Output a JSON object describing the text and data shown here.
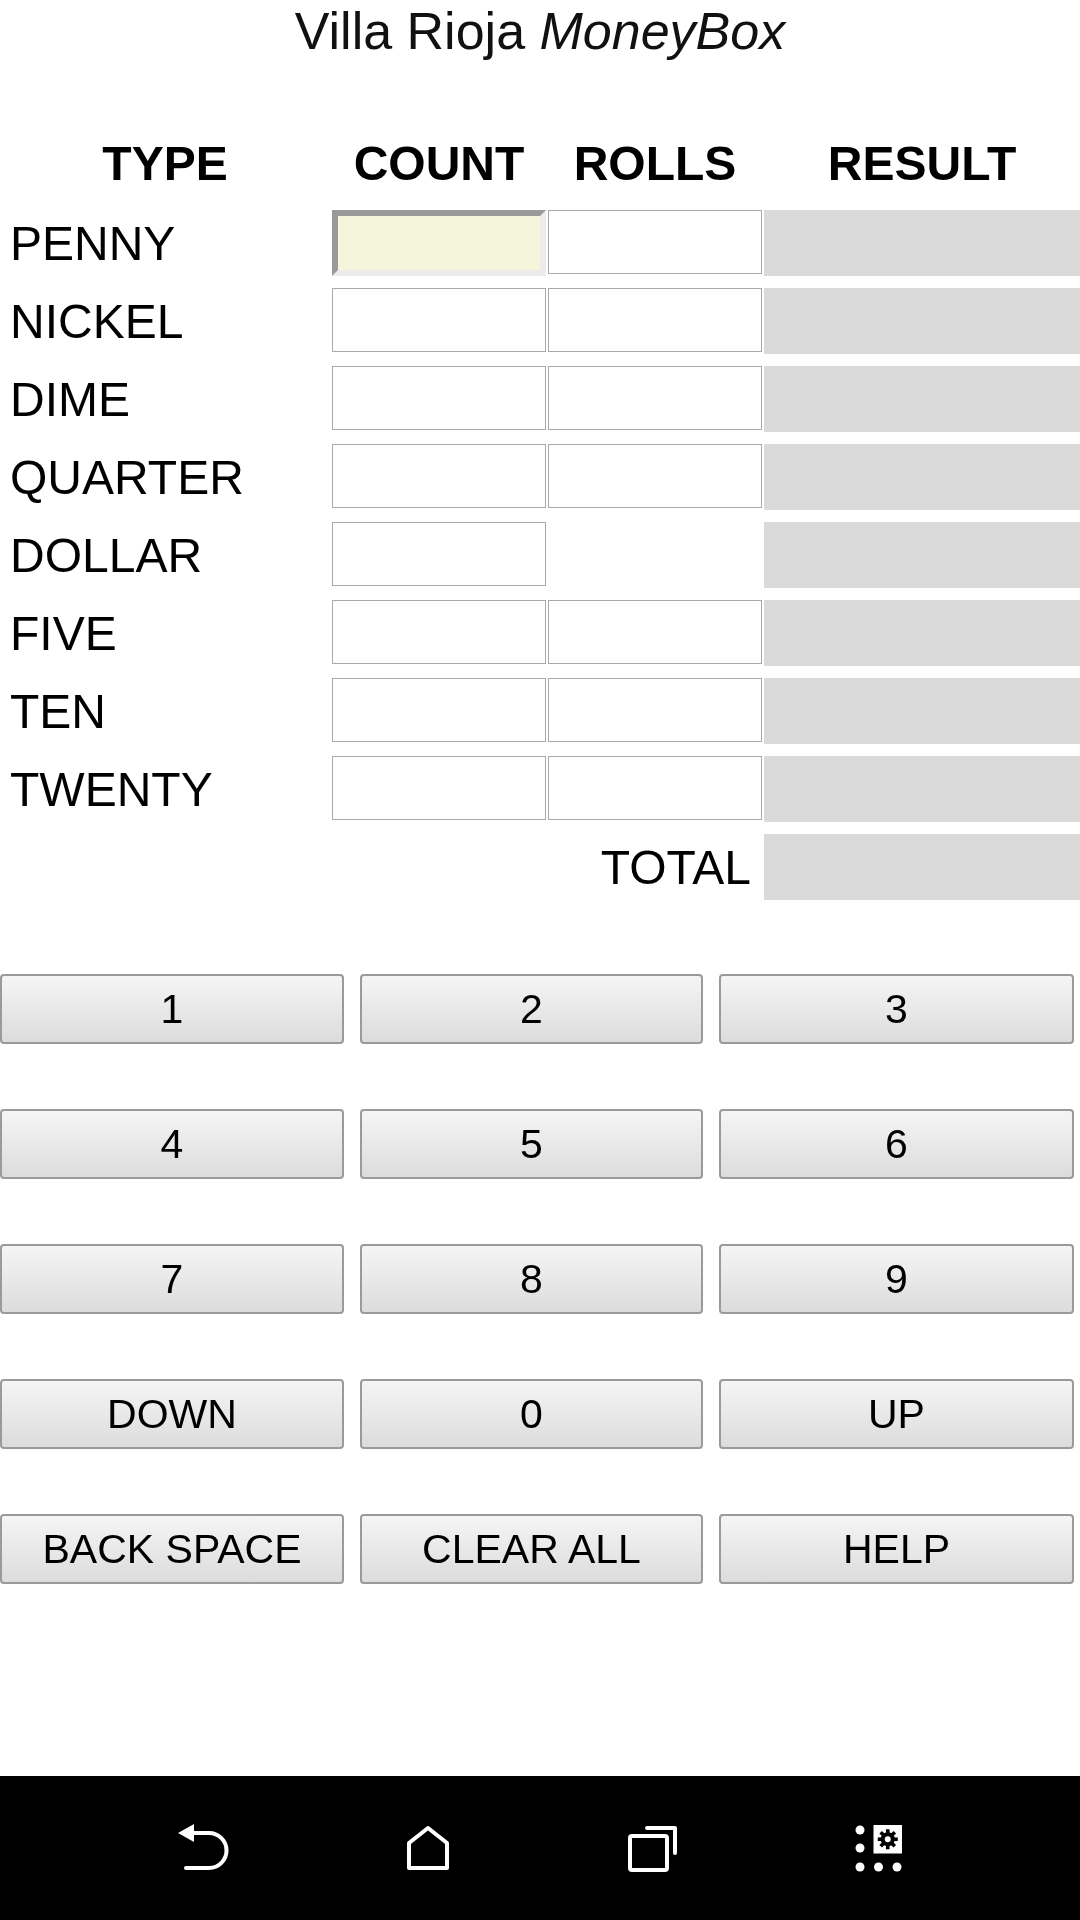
{
  "title": "Villa Rioja *MoneyBox*",
  "table": {
    "columns": [
      "TYPE",
      "COUNT",
      "ROLLS",
      "RESULT"
    ],
    "rows": [
      {
        "label": "PENNY",
        "count": {
          "focused": true
        },
        "rolls": {
          "focused": false
        }
      },
      {
        "label": "NICKEL",
        "count": {
          "focused": false
        },
        "rolls": {
          "focused": false
        }
      },
      {
        "label": "DIME",
        "count": {
          "focused": false
        },
        "rolls": {
          "focused": false
        }
      },
      {
        "label": "QUARTER",
        "count": {
          "focused": false
        },
        "rolls": {
          "focused": false
        }
      },
      {
        "label": "DOLLAR",
        "count": {
          "focused": false
        }
      },
      {
        "label": "FIVE",
        "count": {
          "focused": false
        },
        "rolls": {
          "focused": false
        }
      },
      {
        "label": "TEN",
        "count": {
          "focused": false
        },
        "rolls": {
          "focused": false
        }
      },
      {
        "label": "TWENTY",
        "count": {
          "focused": false
        },
        "rolls": {
          "focused": false
        }
      }
    ],
    "total_label": "TOTAL"
  },
  "keypad": [
    [
      "1",
      "2",
      "3"
    ],
    [
      "4",
      "5",
      "6"
    ],
    [
      "7",
      "8",
      "9"
    ],
    [
      "DOWN",
      "0",
      "UP"
    ],
    [
      "BACK SPACE",
      "CLEAR ALL",
      "HELP"
    ]
  ]
}
